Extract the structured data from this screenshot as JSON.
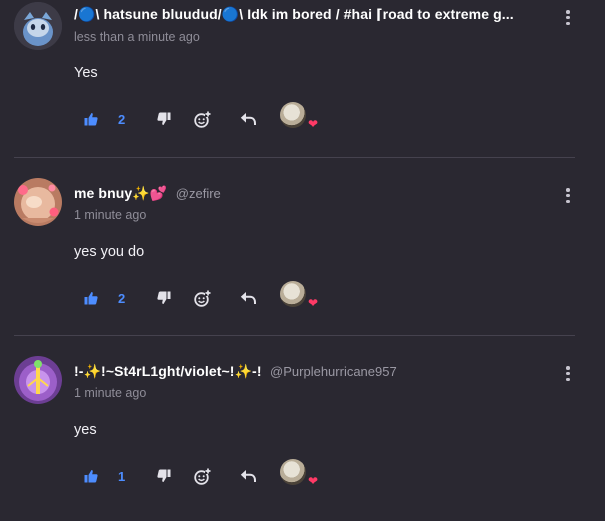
{
  "comments": [
    {
      "name": "/🔵\\ hatsune bluudud/🔵\\ Idk im bored / #hai ⌈road to extreme g...",
      "handle": "",
      "time": "less than a minute ago",
      "text": "Yes",
      "likes": "2"
    },
    {
      "name": "me bnuy✨💕",
      "handle": "@zefire",
      "time": "1 minute ago",
      "text": "yes you do",
      "likes": "2"
    },
    {
      "name": "!-✨!~St4rL1ght/violet~!✨-!",
      "handle": "@Purplehurricane957",
      "time": "1 minute ago",
      "text": "yes",
      "likes": "1"
    }
  ],
  "colors": {
    "background": "#2a2831",
    "accent": "#4d8dff",
    "heart": "#ff3a66",
    "divider": "#45424e"
  },
  "icons": [
    "thumbs-up-icon",
    "thumbs-down-icon",
    "add-reaction-icon",
    "reply-icon",
    "more-options-icon",
    "heart-icon"
  ]
}
